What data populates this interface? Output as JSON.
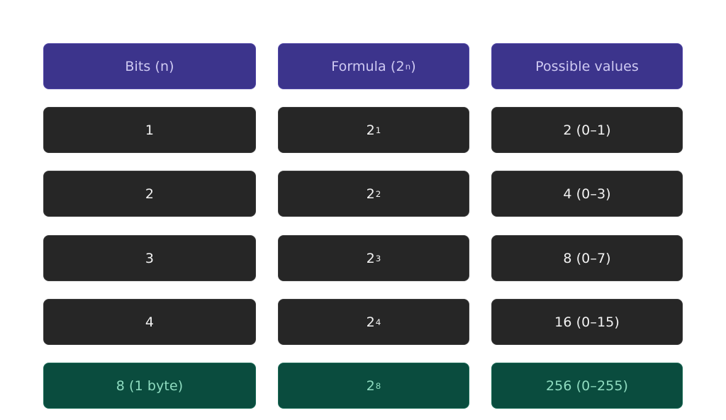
{
  "table": {
    "headers": [
      {
        "base": "Bits (n)",
        "sup": ""
      },
      {
        "base": "Formula (2",
        "sup": "n",
        "suffix": ")"
      },
      {
        "base": "Possible values",
        "sup": ""
      }
    ],
    "rows": [
      {
        "bits": "1",
        "formula_base": "2",
        "formula_exp": "1",
        "values": "2 (0–1)"
      },
      {
        "bits": "2",
        "formula_base": "2",
        "formula_exp": "2",
        "values": "4 (0–3)"
      },
      {
        "bits": "3",
        "formula_base": "2",
        "formula_exp": "3",
        "values": "8 (0–7)"
      },
      {
        "bits": "4",
        "formula_base": "2",
        "formula_exp": "4",
        "values": "16 (0–15)"
      },
      {
        "bits": "8 (1 byte)",
        "formula_base": "2",
        "formula_exp": "8",
        "values": "256 (0–255)",
        "highlight": true
      }
    ]
  },
  "colors": {
    "header_bg": "#3c348c",
    "header_text": "#cfcaf2",
    "row_bg": "#262626",
    "row_text": "#f2f2f2",
    "highlight_bg": "#0a4c3e",
    "highlight_text": "#8fdcc0"
  }
}
